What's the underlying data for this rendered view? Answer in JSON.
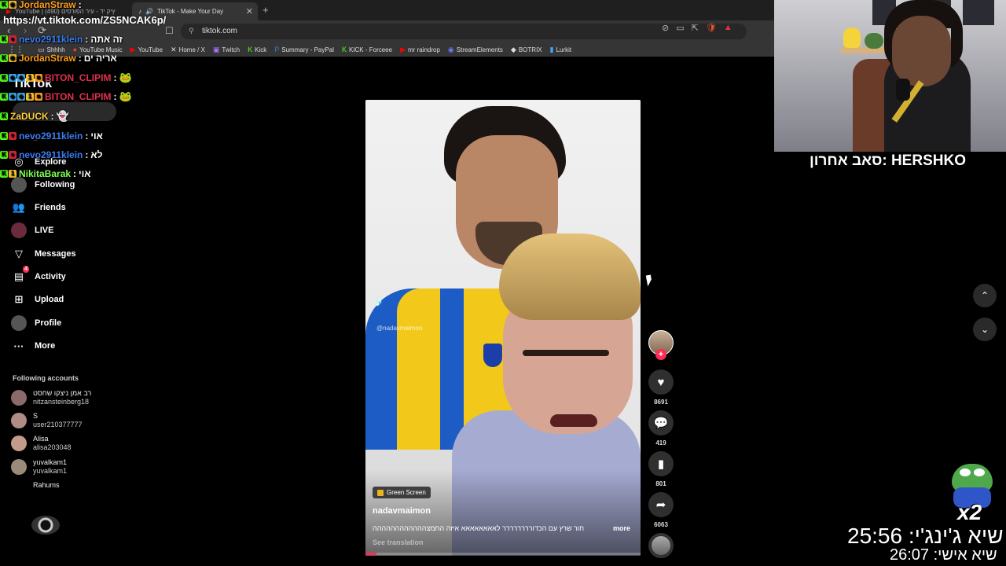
{
  "browser": {
    "tabs": [
      {
        "label": "YouTube | (490) ץיק יד - עיר הפורסים",
        "active": false
      },
      {
        "label": "TikTok - Make Your Day",
        "active": true
      }
    ],
    "new_tab": "+",
    "url": "tiktok.com",
    "bookmarks": [
      {
        "label": "Shhhh",
        "icon": "folder-icon"
      },
      {
        "label": "YouTube Music",
        "icon": "youtube-music-icon"
      },
      {
        "label": "YouTube",
        "icon": "youtube-icon"
      },
      {
        "label": "Home / X",
        "icon": "x-icon"
      },
      {
        "label": "Twitch",
        "icon": "twitch-icon"
      },
      {
        "label": "Kick",
        "icon": "kick-icon"
      },
      {
        "label": "Summary - PayPal",
        "icon": "paypal-icon"
      },
      {
        "label": "KICK - Forceee",
        "icon": "kick-icon"
      },
      {
        "label": "mr raindrop",
        "icon": "youtube-icon"
      },
      {
        "label": "StreamElements",
        "icon": "streamelements-icon"
      },
      {
        "label": "BOTRIX",
        "icon": "botrix-icon"
      },
      {
        "label": "Lurkit",
        "icon": "lurkit-icon"
      }
    ]
  },
  "chat": {
    "link": "https://vt.tiktok.com/ZS5NCAK6p/",
    "messages": [
      {
        "user": "JordanStraw",
        "text": "",
        "color": "#ff9f1c"
      },
      {
        "user": "nevo2911klein",
        "text": "זה אתה",
        "color": "#3a7df0"
      },
      {
        "user": "JordanStraw",
        "text": "אריה ים",
        "color": "#ff9f1c"
      },
      {
        "user": "BITON_CLIPIM",
        "text": "",
        "color": "#e0304b"
      },
      {
        "user": "BITON_CLIPIM",
        "text": "",
        "color": "#e0304b"
      },
      {
        "user": "ZaDUCK",
        "text": "",
        "color": "#ffd23f"
      },
      {
        "user": "nevo2911klein",
        "text": "אוי",
        "color": "#3a7df0"
      },
      {
        "user": "nevo2911klein",
        "text": "לא",
        "color": "#3a7df0"
      },
      {
        "user": "NikitaBarak",
        "text": "אוי",
        "color": "#7dff4d"
      }
    ]
  },
  "tiktok": {
    "logo": "TikTok",
    "nav": [
      {
        "label": "Explore",
        "icon": "compass-icon"
      },
      {
        "label": "Following",
        "icon": "following-avatar-icon"
      },
      {
        "label": "Friends",
        "icon": "friends-icon"
      },
      {
        "label": "LIVE",
        "icon": "live-icon"
      },
      {
        "label": "Messages",
        "icon": "messages-icon"
      },
      {
        "label": "Activity",
        "icon": "activity-icon",
        "badge": "4"
      },
      {
        "label": "Upload",
        "icon": "upload-icon"
      },
      {
        "label": "Profile",
        "icon": "profile-avatar-icon"
      },
      {
        "label": "More",
        "icon": "more-icon"
      }
    ],
    "following_title": "Following accounts",
    "following": [
      {
        "name": "רב אמן ניצקו שחסט",
        "user": "nitzansteinberg18"
      },
      {
        "name": "S",
        "user": "user210377777"
      },
      {
        "name": "Alisa",
        "user": "alisa203048"
      },
      {
        "name": "yuvalkam1",
        "user": "yuvalkam1"
      },
      {
        "name": "Rahums",
        "user": ""
      }
    ],
    "video": {
      "watermark_user": "@nadavmaimon",
      "tag": "Green Screen",
      "author": "nadavmaimon",
      "caption": "חור שרץ עם הכדורררררררר לאאאאאאאא איזה החמצהההההההההההה",
      "more": "more",
      "see_translation": "See translation",
      "progress": 0.04
    },
    "actions": {
      "likes": "8691",
      "comments": "419",
      "saves": "801",
      "shares": "6063"
    }
  },
  "overlay": {
    "last_sub": "סאב אחרון: HERSHKO",
    "emote_multiplier": "x2",
    "timer_main": "שיא ג'ינג'י: 25:56",
    "timer_personal": "שיא אישי: 26:07"
  }
}
